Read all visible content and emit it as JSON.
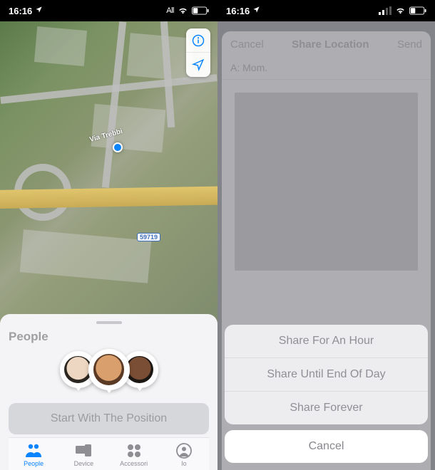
{
  "status": {
    "time": "16:16",
    "carrier_left": "All"
  },
  "left": {
    "map": {
      "street_label": "Via Trebbi",
      "route_shield": "59719"
    },
    "sheet": {
      "title": "People"
    },
    "start_button": "Start With The Position",
    "tabs": {
      "people": "People",
      "device": "Device",
      "accessori": "Accessori",
      "io": "Io"
    }
  },
  "right": {
    "modal": {
      "cancel": "Cancel",
      "title": "Share Location",
      "send": "Send",
      "recipient_prefix": "A:",
      "recipient_name": "Mom."
    },
    "actions": {
      "hour": "Share For An Hour",
      "end_of_day": "Share Until End Of Day",
      "forever": "Share Forever",
      "cancel": "Cancel"
    }
  }
}
